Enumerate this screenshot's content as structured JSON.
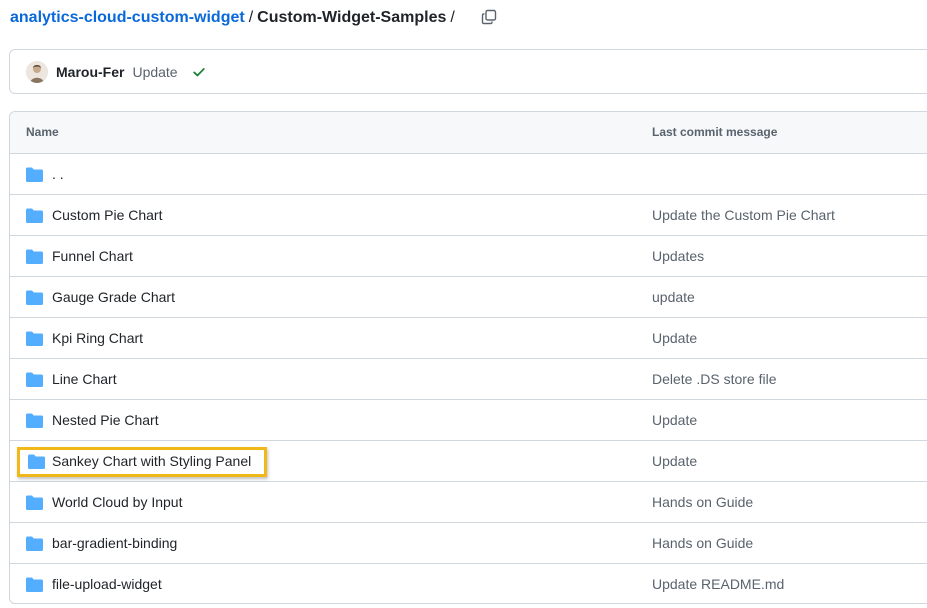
{
  "breadcrumb": {
    "repo": "analytics-cloud-custom-widget",
    "separator": "/",
    "folder": "Custom-Widget-Samples",
    "trailing": "/"
  },
  "copy_icon": "copy-icon",
  "latest_commit": {
    "author": "Marou-Fer",
    "message": "Update",
    "status_icon": "check-icon",
    "status_color": "#1a7f37"
  },
  "table": {
    "headers": {
      "name": "Name",
      "message": "Last commit message"
    },
    "parent_row": {
      "name": ". ."
    },
    "rows": [
      {
        "name": "Custom Pie Chart",
        "message": "Update the Custom Pie Chart"
      },
      {
        "name": "Funnel Chart",
        "message": "Updates"
      },
      {
        "name": "Gauge Grade Chart",
        "message": "update"
      },
      {
        "name": "Kpi Ring Chart",
        "message": "Update"
      },
      {
        "name": "Line Chart",
        "message": "Delete .DS store file"
      },
      {
        "name": "Nested Pie Chart",
        "message": "Update"
      },
      {
        "name": "Sankey Chart with Styling Panel",
        "message": "Update"
      },
      {
        "name": "World Cloud by Input",
        "message": "Hands on Guide"
      },
      {
        "name": "bar-gradient-binding",
        "message": "Hands on Guide"
      },
      {
        "name": "file-upload-widget",
        "message": "Update README.md"
      }
    ]
  },
  "colors": {
    "link": "#0969da",
    "folder": "#54aeff",
    "highlight": "#f1b819"
  }
}
